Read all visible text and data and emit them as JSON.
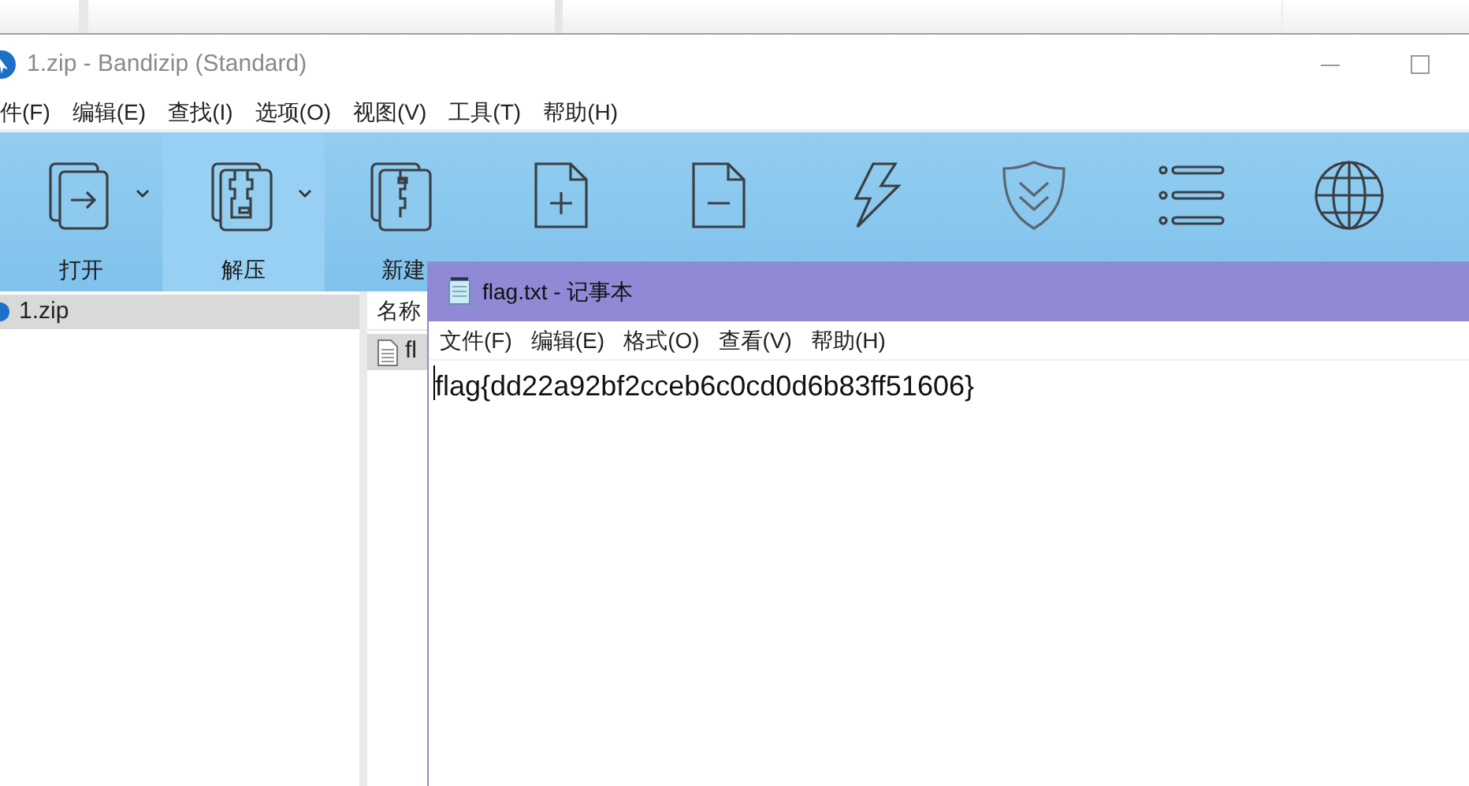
{
  "main_window": {
    "title": "1.zip - Bandizip (Standard)"
  },
  "menu": [
    "件(F)",
    "编辑(E)",
    "查找(I)",
    "选项(O)",
    "视图(V)",
    "工具(T)",
    "帮助(H)"
  ],
  "toolbar": [
    {
      "kind": "open",
      "label": "打开",
      "dropdown": true,
      "selected": false
    },
    {
      "kind": "extract",
      "label": "解压",
      "dropdown": true,
      "selected": true
    },
    {
      "kind": "new",
      "label": "新建",
      "dropdown": false,
      "selected": false
    },
    {
      "kind": "add",
      "dropdown": false,
      "selected": false
    },
    {
      "kind": "delete",
      "dropdown": false,
      "selected": false
    },
    {
      "kind": "test",
      "dropdown": false,
      "selected": false
    },
    {
      "kind": "scan",
      "dropdown": false,
      "selected": false
    },
    {
      "kind": "view",
      "dropdown": false,
      "selected": false
    },
    {
      "kind": "codepage",
      "dropdown": false,
      "selected": false
    }
  ],
  "tree": [
    {
      "label": "1.zip",
      "selected": true
    }
  ],
  "file_list": {
    "columns": [
      "名称"
    ],
    "rows": [
      {
        "name": "fl",
        "selected": true
      }
    ]
  },
  "notepad": {
    "title": "flag.txt - 记事本",
    "menu": [
      "文件(F)",
      "编辑(E)",
      "格式(O)",
      "查看(V)",
      "帮助(H)"
    ],
    "content": "flag{dd22a92bf2cceb6c0cd0d6b83ff51606}"
  }
}
